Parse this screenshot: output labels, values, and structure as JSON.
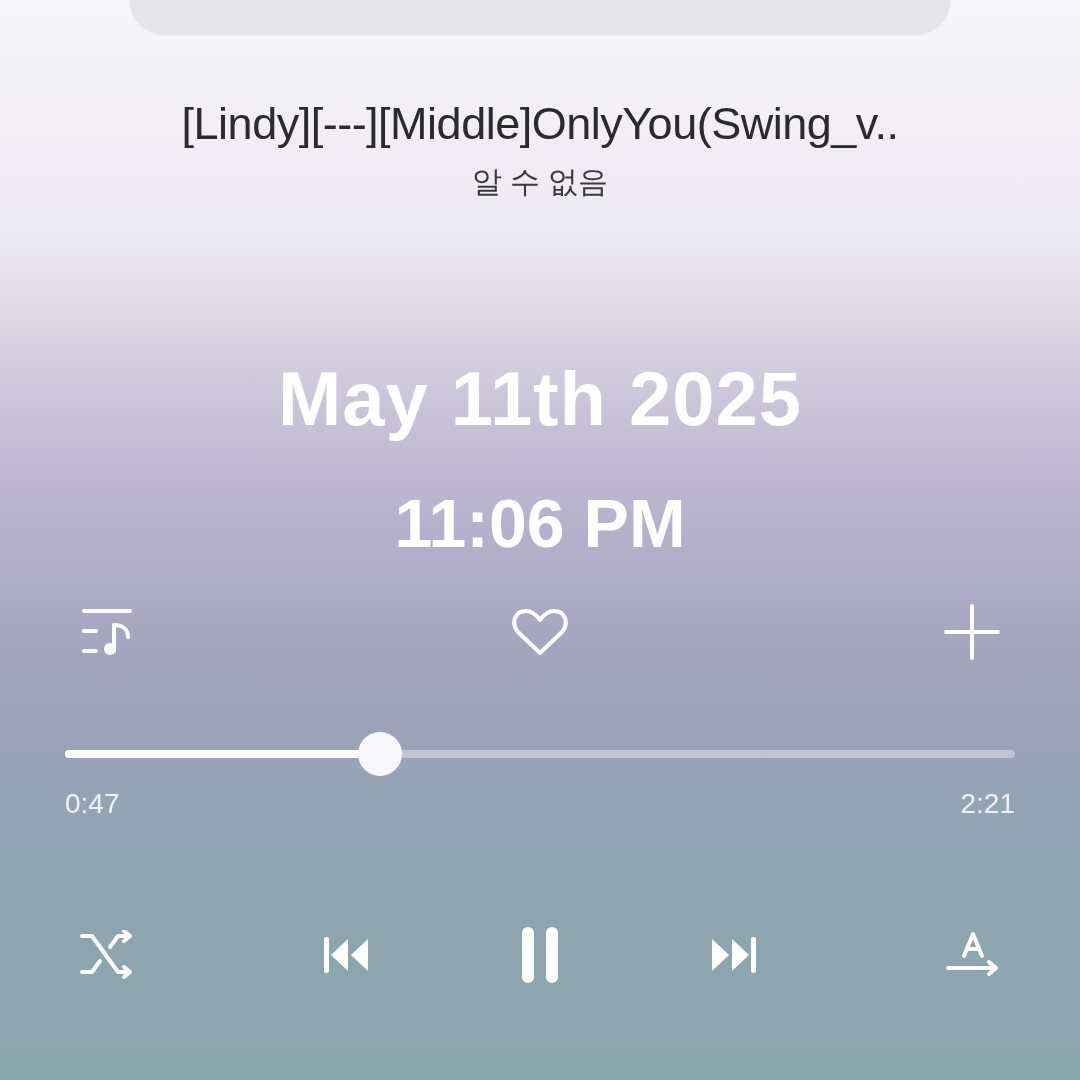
{
  "track": {
    "title": "[Lindy][---][Middle]OnlyYou(Swing_v..",
    "artist": "알 수 없음"
  },
  "timestamp": {
    "date": "May 11th 2025",
    "time": "11:06 PM"
  },
  "progress": {
    "level": 0.332,
    "elapsed": "0:47",
    "total": "2:21"
  },
  "favorite": {
    "on": false
  }
}
